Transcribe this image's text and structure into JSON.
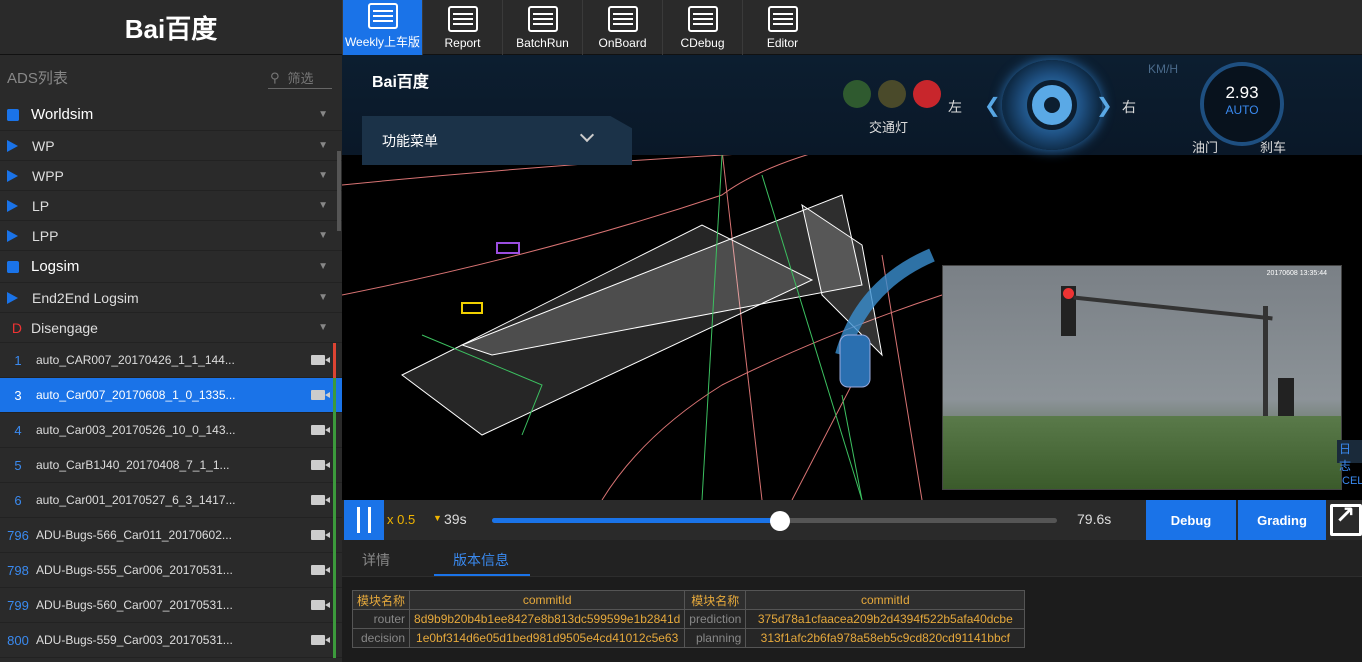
{
  "brand": {
    "logo_text": "Bai百度",
    "hud_logo_text": "Bai百度"
  },
  "nav": [
    {
      "label": "Weekly上车版",
      "icon": "clapboard-w-icon",
      "active": true
    },
    {
      "label": "Report",
      "icon": "report-icon",
      "active": false
    },
    {
      "label": "BatchRun",
      "icon": "batch-run-icon",
      "active": false
    },
    {
      "label": "OnBoard",
      "icon": "car-icon",
      "active": false
    },
    {
      "label": "CDebug",
      "icon": "cloud-gear-icon",
      "active": false
    },
    {
      "label": "Editor",
      "icon": "editor-gear-icon",
      "active": false
    }
  ],
  "sidebar": {
    "title": "ADS列表",
    "search_placeholder": "筛选",
    "groups": [
      {
        "label": "Worldsim"
      },
      {
        "label": "WP"
      },
      {
        "label": "WPP"
      },
      {
        "label": "LP"
      },
      {
        "label": "LPP"
      },
      {
        "label": "Logsim"
      },
      {
        "label": "End2End Logsim"
      },
      {
        "label": "Disengage",
        "prefix": "D"
      }
    ],
    "logs": [
      {
        "num": "1",
        "name": "auto_CAR007_20170426_1_1_144...",
        "status": "red",
        "selected": false
      },
      {
        "num": "3",
        "name": "auto_Car007_20170608_1_0_1335...",
        "status": "green",
        "selected": true
      },
      {
        "num": "4",
        "name": "auto_Car003_20170526_10_0_143...",
        "status": "green",
        "selected": false
      },
      {
        "num": "5",
        "name": "auto_CarB1J40_20170408_7_1_1...",
        "status": "green",
        "selected": false
      },
      {
        "num": "6",
        "name": "auto_Car001_20170527_6_3_1417...",
        "status": "green",
        "selected": false
      },
      {
        "num": "796",
        "name": "ADU-Bugs-566_Car011_20170602...",
        "status": "green",
        "selected": false
      },
      {
        "num": "798",
        "name": "ADU-Bugs-555_Car006_20170531...",
        "status": "green",
        "selected": false
      },
      {
        "num": "799",
        "name": "ADU-Bugs-560_Car007_20170531...",
        "status": "green",
        "selected": false
      },
      {
        "num": "800",
        "name": "ADU-Bugs-559_Car003_20170531...",
        "status": "green",
        "selected": false
      }
    ]
  },
  "hud": {
    "function_menu": "功能菜单",
    "traffic_light_label": "交通灯",
    "traffic_lights": [
      "#2f5a2f",
      "#4a4a2a",
      "#c8262c"
    ],
    "left_label": "左",
    "right_label": "右",
    "speed_unit": "KM/H",
    "speed_value": "2.93",
    "drive_mode": "AUTO",
    "throttle_label": "油门",
    "brake_label": "刹车",
    "camera_timestamp": "20170608 13:35:44",
    "side_tab_1": "日志",
    "side_tab_2": "CEL"
  },
  "playback": {
    "rate": "x 0.5",
    "current_time": "39s",
    "total_time": "79.6s",
    "progress": 0.51,
    "debug_label": "Debug",
    "grading_label": "Grading"
  },
  "tabs": [
    {
      "label": "详情",
      "active": false
    },
    {
      "label": "版本信息",
      "active": true
    }
  ],
  "version_table": {
    "headers": [
      "模块名称",
      "commitId",
      "模块名称",
      "commitId"
    ],
    "rows": [
      [
        "router",
        "8d9b9b20b4b1ee8427e8b813dc599599e1b2841d",
        "prediction",
        "375d78a1cfaacea209b2d4394f522b5afa40dcbe"
      ],
      [
        "decision",
        "1e0bf314d6e05d1bed981d9505e4cd41012c5e63",
        "planning",
        "313f1afc2b6fa978a58eb5c9cd820cd91141bbcf"
      ]
    ]
  },
  "colors": {
    "accent": "#1a73e8",
    "commit": "#e6a93c",
    "ok": "#3c9a3c",
    "error": "#d43"
  }
}
